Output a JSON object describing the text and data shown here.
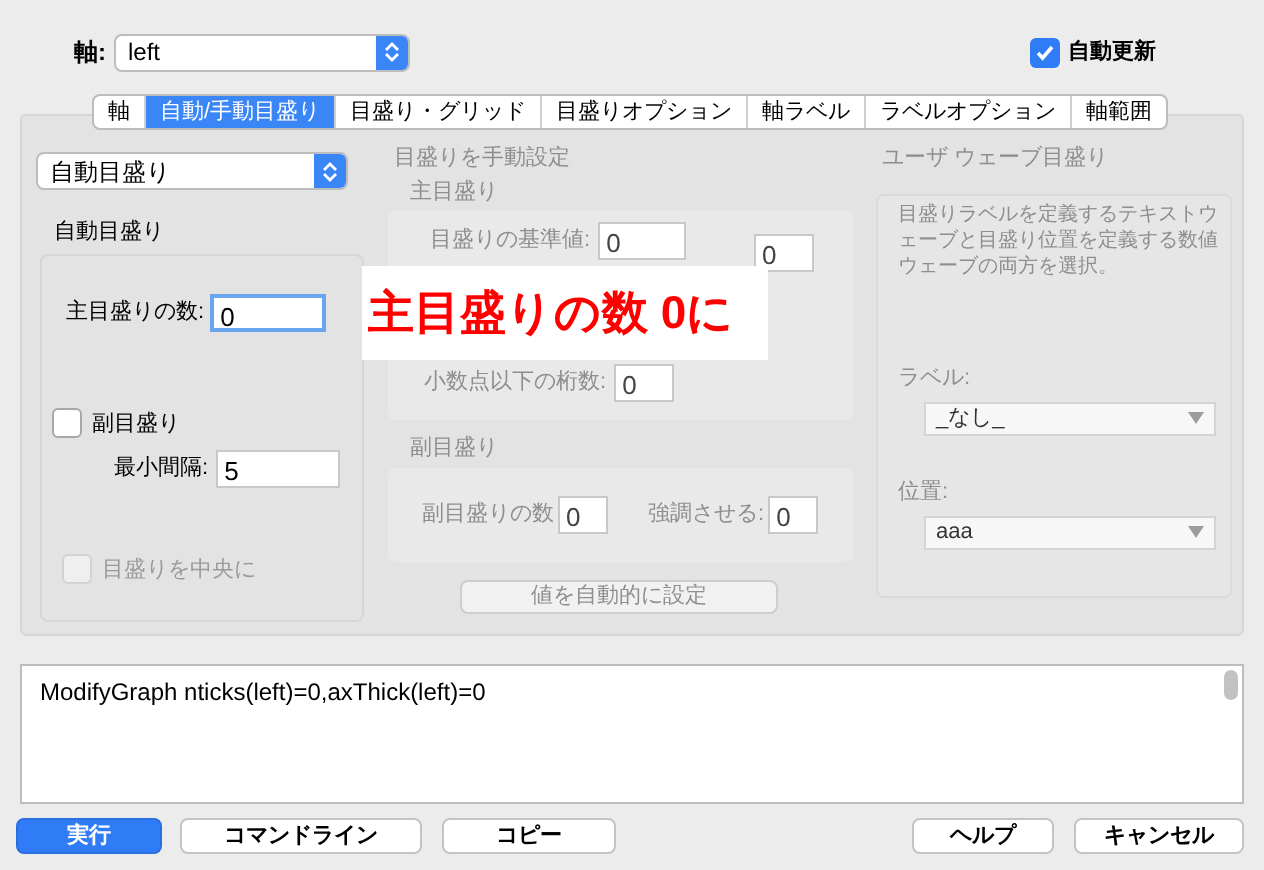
{
  "axis": {
    "label": "軸:",
    "value": "left"
  },
  "auto_update": {
    "label": "自動更新",
    "checked": true
  },
  "tabs": [
    {
      "label": "軸",
      "selected": false
    },
    {
      "label": "自動/手動目盛り",
      "selected": true
    },
    {
      "label": "目盛り・グリッド",
      "selected": false
    },
    {
      "label": "目盛りオプション",
      "selected": false
    },
    {
      "label": "軸ラベル",
      "selected": false
    },
    {
      "label": "ラベルオプション",
      "selected": false
    },
    {
      "label": "軸範囲",
      "selected": false
    }
  ],
  "mode_select": {
    "value": "自動目盛り"
  },
  "auto_ticks": {
    "title": "自動目盛り",
    "major_count": {
      "label": "主目盛りの数:",
      "value": "0",
      "focused": true
    },
    "minor_ticks": {
      "label": "副目盛り",
      "checked": false
    },
    "min_spacing": {
      "label": "最小間隔:",
      "value": "5"
    },
    "center_ticks": {
      "label": "目盛りを中央に",
      "checked": false,
      "disabled": true
    }
  },
  "manual": {
    "title": "目盛りを手動設定",
    "disabled": true,
    "major": {
      "title": "主目盛り",
      "base": {
        "label": "目盛りの基準値:",
        "value": "0"
      },
      "exponent": {
        "value": "0"
      },
      "digits": {
        "label": "小数点以下の桁数:",
        "value": "0"
      }
    },
    "minor": {
      "title": "副目盛り",
      "count": {
        "label": "副目盛りの数",
        "value": "0"
      },
      "emphasize": {
        "label": "強調させる:",
        "value": "0"
      }
    },
    "button": "値を自動的に設定"
  },
  "user_wave": {
    "title": "ユーザ ウェーブ目盛り",
    "disabled": true,
    "description": "目盛りラベルを定義するテキストウェーブと目盛り位置を定義する数値ウェーブの両方を選択。",
    "label_select": {
      "label": "ラベル:",
      "value": "_なし_"
    },
    "position_select": {
      "label": "位置:",
      "value": "aaa"
    }
  },
  "annotation": "主目盛りの数 0に",
  "command": "ModifyGraph nticks(left)=0,axThick(left)=0",
  "buttons": [
    {
      "label": "実行",
      "default": true
    },
    {
      "label": "コマンドライン",
      "default": false
    },
    {
      "label": "コピー",
      "default": false
    },
    {
      "label": "ヘルプ",
      "default": false
    },
    {
      "label": "キャンセル",
      "default": false
    }
  ]
}
